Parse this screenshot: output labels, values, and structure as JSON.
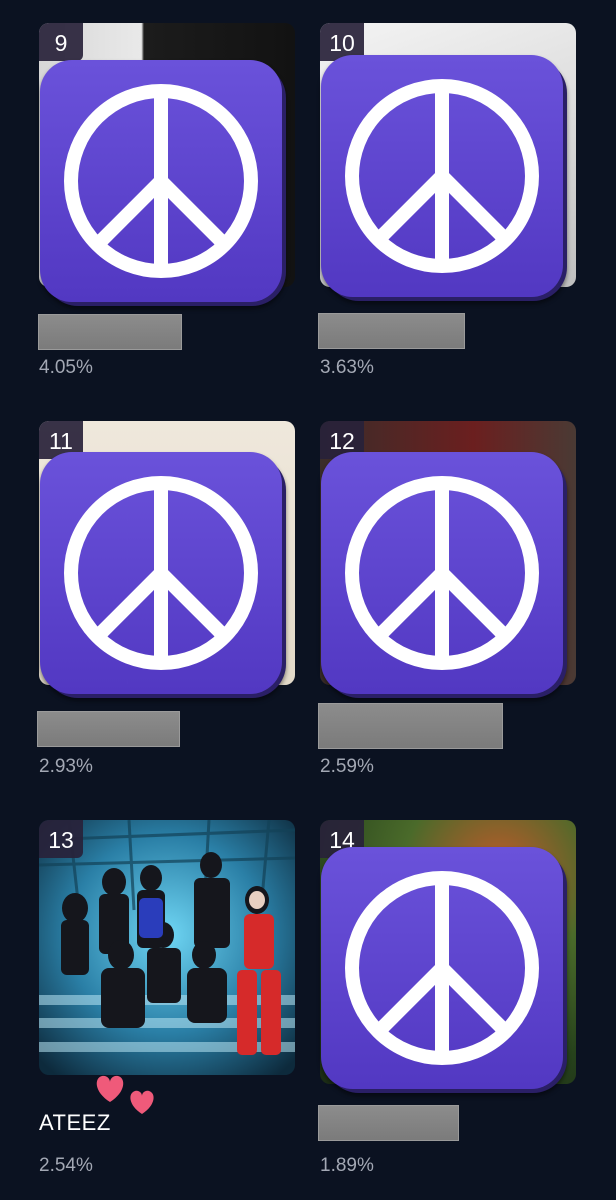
{
  "colors": {
    "background": "#0b1221",
    "peace_purple": "#5f47cf",
    "percent_text": "#a3a8b4",
    "heart": "#ef5a7a"
  },
  "icons": {
    "peace": "peace-sign-icon",
    "heart": "heart-icon"
  },
  "rankings": [
    {
      "rank": "9",
      "name": "",
      "percent": "4.05%",
      "name_hidden": true
    },
    {
      "rank": "10",
      "name": "",
      "percent": "3.63%",
      "name_hidden": true
    },
    {
      "rank": "11",
      "name": "",
      "percent": "2.93%",
      "name_hidden": true
    },
    {
      "rank": "12",
      "name": "",
      "percent": "2.59%",
      "name_hidden": true
    },
    {
      "rank": "13",
      "name": "ATEEZ",
      "percent": "2.54%",
      "name_hidden": false
    },
    {
      "rank": "14",
      "name": "",
      "percent": "1.89%",
      "name_hidden": true
    }
  ]
}
